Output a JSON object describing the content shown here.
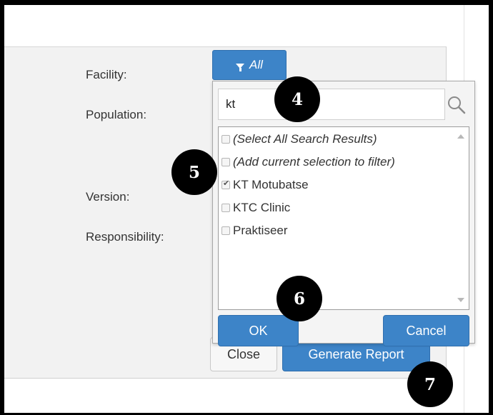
{
  "form": {
    "facility_label": "Facility:",
    "population_label": "Population:",
    "version_label": "Version:",
    "responsibility_label": "Responsibility:"
  },
  "filter_button": {
    "label": "All",
    "icon": "filter-icon"
  },
  "dropdown": {
    "search_value": "kt",
    "search_icon": "search-icon",
    "items": [
      {
        "label": "(Select All Search Results)",
        "checked": false
      },
      {
        "label": "(Add current selection to filter)",
        "checked": false
      },
      {
        "label": "KT Motubatse",
        "checked": true
      },
      {
        "label": "KTC Clinic",
        "checked": false
      },
      {
        "label": "Praktiseer",
        "checked": false
      }
    ],
    "ok_label": "OK",
    "cancel_label": "Cancel"
  },
  "footer": {
    "close_label": "Close",
    "generate_label": "Generate Report"
  },
  "markers": [
    "4",
    "5",
    "6",
    "7"
  ],
  "colors": {
    "primary_button": "#3d84c8",
    "panel_bg": "#f2f2f2"
  }
}
